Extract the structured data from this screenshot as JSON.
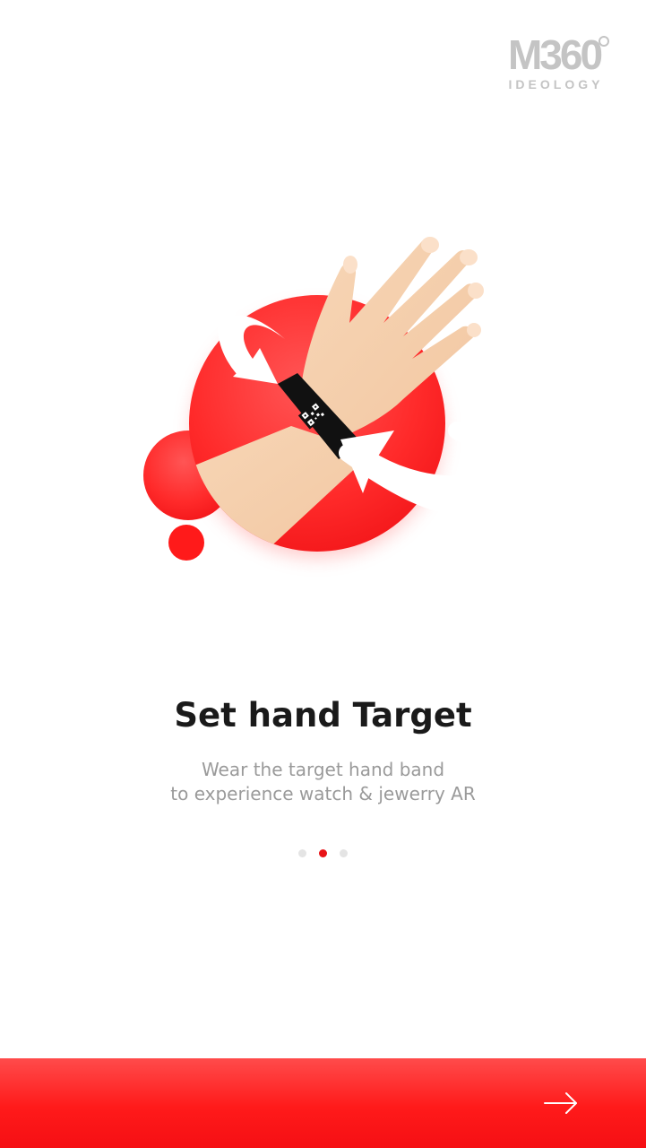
{
  "brand": {
    "logo_text": "M360",
    "tagline": "IDEOLOGY"
  },
  "onboarding": {
    "title": "Set hand Target",
    "subtitle_line1": "Wear the target hand band",
    "subtitle_line2": "to experience watch & jewerry AR",
    "page_indicator": {
      "total": 3,
      "active_index": 1
    }
  },
  "illustration": {
    "icon": "hand-with-wristband-icon"
  },
  "footer": {
    "next_icon": "arrow-right-icon"
  },
  "colors": {
    "accent": "#ff1a1a",
    "accent_dark": "#e81317",
    "skin": "#f5cfad",
    "band": "#111111",
    "text_primary": "#1a1a1a",
    "text_secondary": "#9a9a9a",
    "logo_gray": "#c4c4c4"
  }
}
